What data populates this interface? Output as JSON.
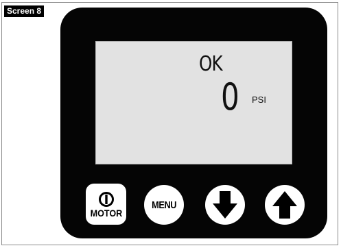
{
  "screen_tag": "Screen 8",
  "display": {
    "status": "OK",
    "pressure_value": "0",
    "pressure_unit": "PSI"
  },
  "buttons": {
    "motor_label": "MOTOR",
    "menu_label": "MENU",
    "down_icon": "arrow-down-icon",
    "up_icon": "arrow-up-icon",
    "power_icon": "power-icon"
  },
  "colors": {
    "device_body": "#050505",
    "lcd_background": "#e2e2e2",
    "button_face": "#ffffff",
    "tag_background": "#000000"
  }
}
